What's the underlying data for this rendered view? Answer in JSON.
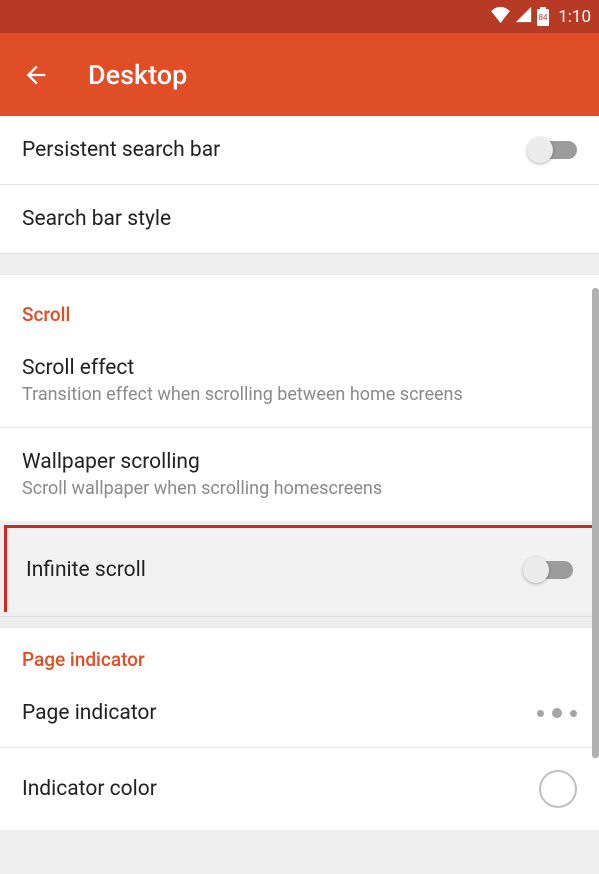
{
  "status": {
    "battery_pct": "84",
    "time": "1:10"
  },
  "header": {
    "title": "Desktop"
  },
  "rows": {
    "persistent_search": {
      "title": "Persistent search bar"
    },
    "search_bar_style": {
      "title": "Search bar style"
    }
  },
  "sections": {
    "scroll": {
      "header": "Scroll",
      "scroll_effect": {
        "title": "Scroll effect",
        "subtitle": "Transition effect when scrolling between home screens"
      },
      "wallpaper_scrolling": {
        "title": "Wallpaper scrolling",
        "subtitle": "Scroll wallpaper when scrolling homescreens"
      },
      "infinite_scroll": {
        "title": "Infinite scroll"
      }
    },
    "page_indicator": {
      "header": "Page indicator",
      "page_indicator": {
        "title": "Page indicator"
      },
      "indicator_color": {
        "title": "Indicator color"
      }
    }
  }
}
